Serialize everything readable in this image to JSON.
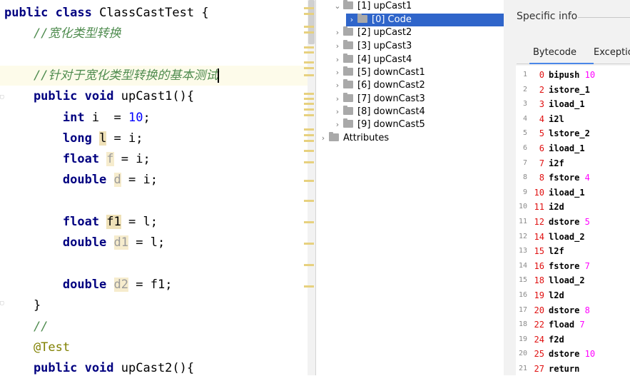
{
  "editor": {
    "lines": [
      {
        "parts": [
          {
            "t": "public class ",
            "c": "kw"
          },
          {
            "t": "ClassCastTest {",
            "c": ""
          }
        ]
      },
      {
        "parts": [
          {
            "t": "    //宽化类型转换",
            "c": "cmt green"
          }
        ]
      },
      {
        "parts": [
          {
            "t": "",
            "c": ""
          }
        ]
      },
      {
        "parts": [
          {
            "t": "    //针对于宽化类型转换的基本测试",
            "c": "cmt green"
          }
        ]
      },
      {
        "parts": [
          {
            "t": "    public void ",
            "c": "kw"
          },
          {
            "t": "upCast1(){",
            "c": ""
          }
        ]
      },
      {
        "parts": [
          {
            "t": "        int ",
            "c": "kw"
          },
          {
            "t": "i  = ",
            "c": ""
          },
          {
            "t": "10",
            "c": "num"
          },
          {
            "t": ";",
            "c": ""
          }
        ]
      },
      {
        "parts": [
          {
            "t": "        long ",
            "c": "kw"
          },
          {
            "t": "l",
            "c": "hl2"
          },
          {
            "t": " = i;",
            "c": ""
          }
        ]
      },
      {
        "parts": [
          {
            "t": "        float ",
            "c": "kw"
          },
          {
            "t": "f",
            "c": "hl gray"
          },
          {
            "t": " = i;",
            "c": ""
          }
        ]
      },
      {
        "parts": [
          {
            "t": "        double ",
            "c": "kw"
          },
          {
            "t": "d",
            "c": "hl gray"
          },
          {
            "t": " = i;",
            "c": ""
          }
        ]
      },
      {
        "parts": [
          {
            "t": "",
            "c": ""
          }
        ]
      },
      {
        "parts": [
          {
            "t": "        float ",
            "c": "kw"
          },
          {
            "t": "f1",
            "c": "hl2"
          },
          {
            "t": " = l;",
            "c": ""
          }
        ]
      },
      {
        "parts": [
          {
            "t": "        double ",
            "c": "kw"
          },
          {
            "t": "d1",
            "c": "hl gray"
          },
          {
            "t": " = l;",
            "c": ""
          }
        ]
      },
      {
        "parts": [
          {
            "t": "",
            "c": ""
          }
        ]
      },
      {
        "parts": [
          {
            "t": "        double ",
            "c": "kw"
          },
          {
            "t": "d2",
            "c": "hl gray"
          },
          {
            "t": " = f1;",
            "c": ""
          }
        ]
      },
      {
        "parts": [
          {
            "t": "    }",
            "c": ""
          }
        ]
      },
      {
        "parts": [
          {
            "t": "    //",
            "c": "cmt green"
          }
        ]
      },
      {
        "parts": [
          {
            "t": "    @Test",
            "c": "ann"
          }
        ]
      },
      {
        "parts": [
          {
            "t": "    public void ",
            "c": "kw"
          },
          {
            "t": "upCast2(){",
            "c": ""
          }
        ]
      }
    ]
  },
  "tree": {
    "items": [
      {
        "label": "[1] upCast1",
        "arrow": "⌄",
        "depth": 1,
        "selected": false,
        "folder": true
      },
      {
        "label": "[0] Code",
        "arrow": "›",
        "depth": 2,
        "selected": true,
        "folder": true
      },
      {
        "label": "[2] upCast2",
        "arrow": "›",
        "depth": 1,
        "selected": false,
        "folder": true
      },
      {
        "label": "[3] upCast3",
        "arrow": "›",
        "depth": 1,
        "selected": false,
        "folder": true
      },
      {
        "label": "[4] upCast4",
        "arrow": "›",
        "depth": 1,
        "selected": false,
        "folder": true
      },
      {
        "label": "[5] downCast1",
        "arrow": "›",
        "depth": 1,
        "selected": false,
        "folder": true
      },
      {
        "label": "[6] downCast2",
        "arrow": "›",
        "depth": 1,
        "selected": false,
        "folder": true
      },
      {
        "label": "[7] downCast3",
        "arrow": "›",
        "depth": 1,
        "selected": false,
        "folder": true
      },
      {
        "label": "[8] downCast4",
        "arrow": "›",
        "depth": 1,
        "selected": false,
        "folder": true
      },
      {
        "label": "[9] downCast5",
        "arrow": "›",
        "depth": 1,
        "selected": false,
        "folder": true
      },
      {
        "label": "Attributes",
        "arrow": "›",
        "depth": 0,
        "selected": false,
        "folder": true
      }
    ]
  },
  "info": {
    "title": "Specific info",
    "tabs": [
      "Bytecode",
      "Exceptio"
    ],
    "bytecode": [
      {
        "ln": "1",
        "off": "0",
        "op": "bipush",
        "arg": "10"
      },
      {
        "ln": "2",
        "off": "2",
        "op": "istore_1",
        "arg": ""
      },
      {
        "ln": "3",
        "off": "3",
        "op": "iload_1",
        "arg": ""
      },
      {
        "ln": "4",
        "off": "4",
        "op": "i2l",
        "arg": ""
      },
      {
        "ln": "5",
        "off": "5",
        "op": "lstore_2",
        "arg": ""
      },
      {
        "ln": "6",
        "off": "6",
        "op": "iload_1",
        "arg": ""
      },
      {
        "ln": "7",
        "off": "7",
        "op": "i2f",
        "arg": ""
      },
      {
        "ln": "8",
        "off": "8",
        "op": "fstore",
        "arg": "4"
      },
      {
        "ln": "9",
        "off": "10",
        "op": "iload_1",
        "arg": ""
      },
      {
        "ln": "10",
        "off": "11",
        "op": "i2d",
        "arg": ""
      },
      {
        "ln": "11",
        "off": "12",
        "op": "dstore",
        "arg": "5"
      },
      {
        "ln": "12",
        "off": "14",
        "op": "lload_2",
        "arg": ""
      },
      {
        "ln": "13",
        "off": "15",
        "op": "l2f",
        "arg": ""
      },
      {
        "ln": "14",
        "off": "16",
        "op": "fstore",
        "arg": "7"
      },
      {
        "ln": "15",
        "off": "18",
        "op": "lload_2",
        "arg": ""
      },
      {
        "ln": "16",
        "off": "19",
        "op": "l2d",
        "arg": ""
      },
      {
        "ln": "17",
        "off": "20",
        "op": "dstore",
        "arg": "8"
      },
      {
        "ln": "18",
        "off": "22",
        "op": "fload",
        "arg": "7"
      },
      {
        "ln": "19",
        "off": "24",
        "op": "f2d",
        "arg": ""
      },
      {
        "ln": "20",
        "off": "25",
        "op": "dstore",
        "arg": "10"
      },
      {
        "ln": "21",
        "off": "27",
        "op": "return",
        "arg": ""
      }
    ]
  }
}
